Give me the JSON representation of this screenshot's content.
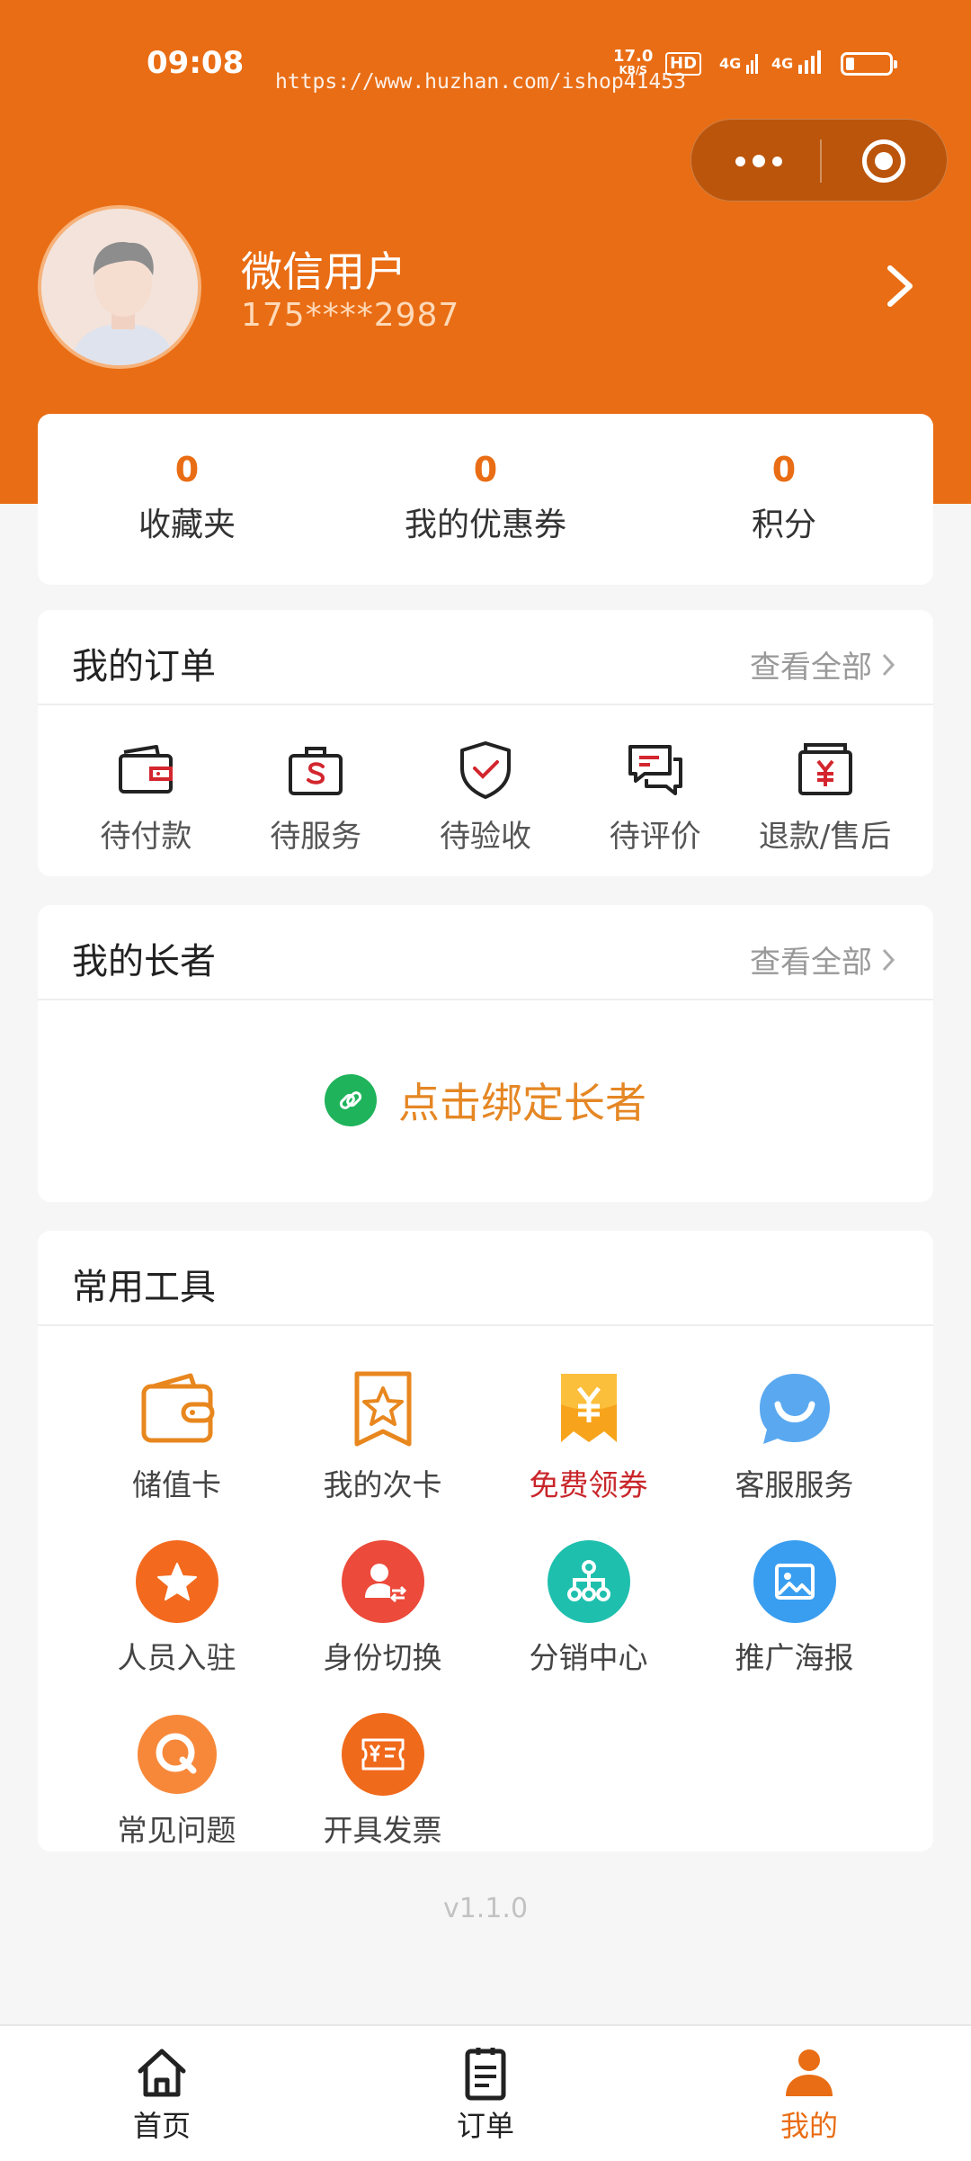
{
  "status_bar": {
    "time": "09:08",
    "net_speed_value": "17.0",
    "net_speed_unit": "KB/S",
    "hd_label": "HD",
    "signal_1": "4G",
    "signal_2": "4G",
    "battery_level": 0.2
  },
  "watermark": "https://www.huzhan.com/ishop41453",
  "profile": {
    "username": "微信用户",
    "phone": "175****2987"
  },
  "stats": [
    {
      "value": "0",
      "label": "收藏夹"
    },
    {
      "value": "0",
      "label": "我的优惠券"
    },
    {
      "value": "0",
      "label": "积分"
    }
  ],
  "orders": {
    "title": "我的订单",
    "view_all": "查看全部",
    "items": [
      {
        "label": "待付款",
        "icon": "wallet-icon"
      },
      {
        "label": "待服务",
        "icon": "service-bag-icon"
      },
      {
        "label": "待验收",
        "icon": "shield-check-icon"
      },
      {
        "label": "待评价",
        "icon": "chat-bubble-icon"
      },
      {
        "label": "退款/售后",
        "icon": "refund-yen-icon"
      }
    ]
  },
  "elders": {
    "title": "我的长者",
    "view_all": "查看全部",
    "bind_text": "点击绑定长者"
  },
  "tools": {
    "title": "常用工具",
    "items": [
      {
        "label": "储值卡",
        "icon": "stored-value-card-icon"
      },
      {
        "label": "我的次卡",
        "icon": "star-bookmark-icon"
      },
      {
        "label": "免费领券",
        "icon": "yen-coupon-icon"
      },
      {
        "label": "客服服务",
        "icon": "customer-service-icon"
      },
      {
        "label": "人员入驻",
        "icon": "star-circle-icon"
      },
      {
        "label": "身份切换",
        "icon": "switch-identity-icon"
      },
      {
        "label": "分销中心",
        "icon": "distribution-icon"
      },
      {
        "label": "推广海报",
        "icon": "poster-image-icon"
      },
      {
        "label": "常见问题",
        "icon": "faq-icon"
      },
      {
        "label": "开具发票",
        "icon": "invoice-icon"
      }
    ]
  },
  "version": "v1.1.0",
  "tabbar": [
    {
      "label": "首页",
      "icon": "home-icon"
    },
    {
      "label": "订单",
      "icon": "order-list-icon"
    },
    {
      "label": "我的",
      "icon": "user-icon"
    }
  ],
  "colors": {
    "primary": "#e96d14",
    "accent_text": "#e58724",
    "coupon_red": "#c8262a",
    "bind_green": "#1fb35b"
  }
}
